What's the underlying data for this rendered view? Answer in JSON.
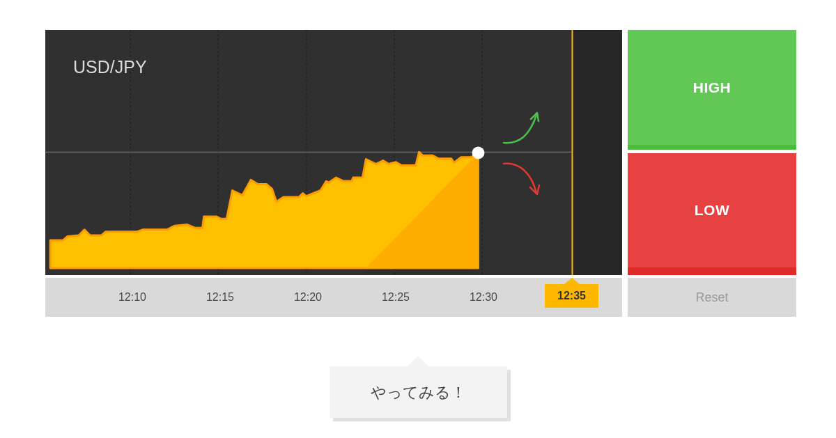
{
  "chart": {
    "symbol": "USD/JPY",
    "time_labels": [
      "12:10",
      "12:15",
      "12:20",
      "12:25",
      "12:30"
    ],
    "expiry_time": "12:35"
  },
  "trade_buttons": [
    {
      "kind": "high",
      "label": "HIGH"
    },
    {
      "kind": "low",
      "label": "LOW"
    }
  ],
  "reset_button": {
    "label": "Reset"
  },
  "cta_button": {
    "label": "やってみる！"
  }
}
